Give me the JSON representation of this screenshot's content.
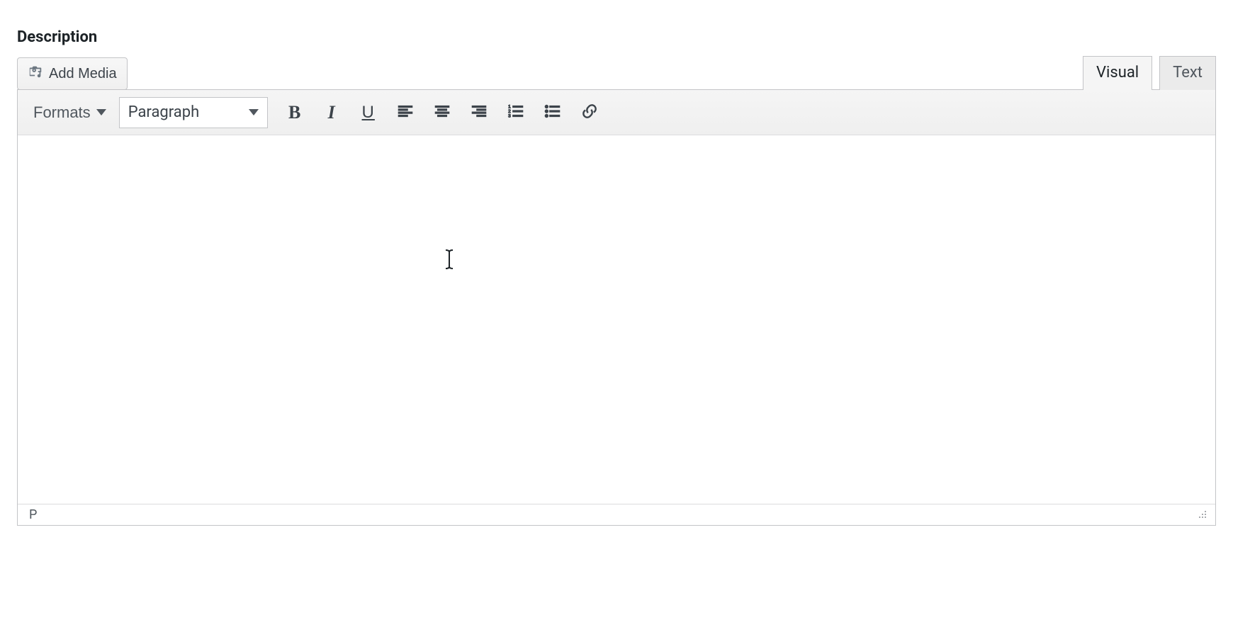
{
  "section_title": "Description",
  "add_media_label": "Add Media",
  "tabs": {
    "visual": "Visual",
    "text": "Text",
    "active": "visual"
  },
  "toolbar": {
    "formats_label": "Formats",
    "block_selected": "Paragraph"
  },
  "status": {
    "path": "P"
  },
  "editor": {
    "content": ""
  }
}
